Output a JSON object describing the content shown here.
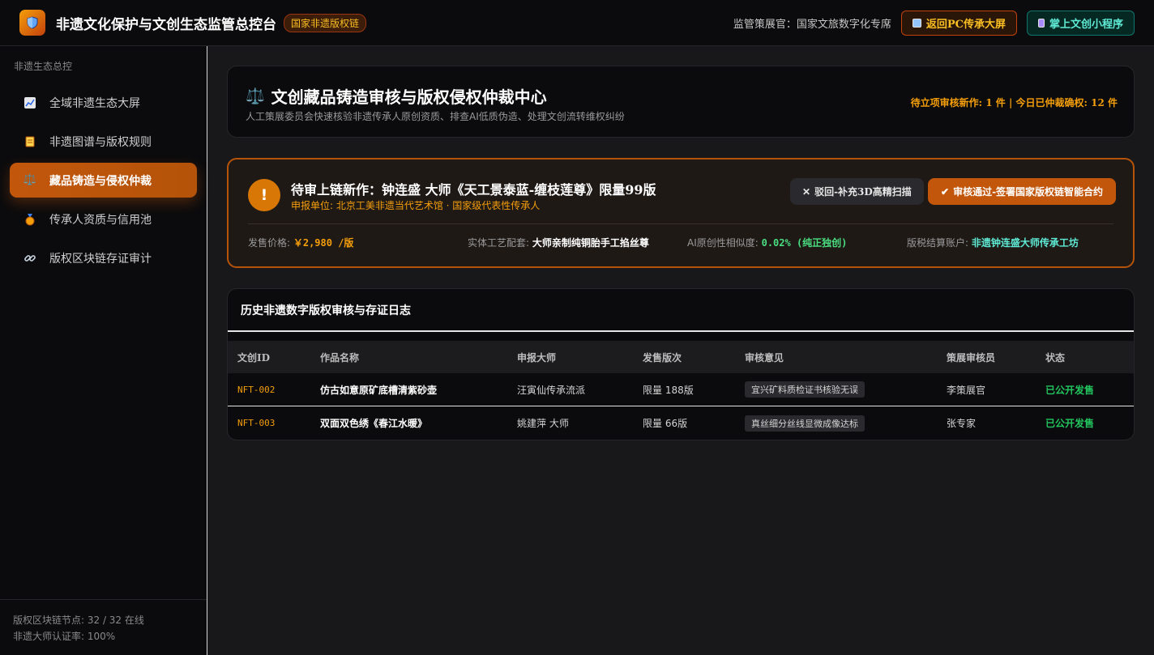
{
  "header": {
    "title": "非遗文化保护与文创生态监管总控台",
    "badge": "国家非遗版权链",
    "curator_label": "监管策展官：国家文旅数字化专席",
    "pc_button": "返回PC传承大屏",
    "mini_button": "掌上文创小程序"
  },
  "sidebar": {
    "section_title": "非遗生态总控",
    "items": [
      {
        "label": "全域非遗生态大屏",
        "icon": "chart-icon"
      },
      {
        "label": "非遗图谱与版权规则",
        "icon": "scroll-icon"
      },
      {
        "label": "藏品铸造与侵权仲裁",
        "icon": "scale-icon",
        "active": true
      },
      {
        "label": "传承人资质与信用池",
        "icon": "medal-icon"
      },
      {
        "label": "版权区块链存证审计",
        "icon": "link-icon"
      }
    ],
    "footer_nodes": "版权区块链节点: 32 / 32 在线",
    "footer_cert": "非遗大师认证率: 100%"
  },
  "page_header": {
    "title": "文创藏品铸造审核与版权侵权仲裁中心",
    "subtitle": "人工策展委员会快速核验非遗传承人原创资质、排查AI低质伪造、处理文创流转维权纠纷",
    "stats": "待立项审核新作: 1 件 | 今日已仲裁确权: 12 件"
  },
  "pending": {
    "icon_glyph": "!",
    "title": "待审上链新作：钟连盛 大师《天工景泰蓝-缠枝莲尊》限量99版",
    "unit": "申报单位: 北京工美非遗当代艺术馆 · 国家级代表性传承人",
    "reject_label": "驳回-补充3D高精扫描",
    "approve_label": "审核通过-签署国家版权链智能合约",
    "meta": [
      {
        "label": "发售价格: ",
        "value": "￥2,980 /版"
      },
      {
        "label": "实体工艺配套: ",
        "value": "大师亲制纯铜胎手工掐丝尊"
      },
      {
        "label": "AI原创性相似度: ",
        "value": "0.02% (纯正独创)"
      },
      {
        "label": "版税结算账户: ",
        "value": "非遗钟连盛大师传承工坊"
      }
    ]
  },
  "log": {
    "title": "历史非遗数字版权审核与存证日志",
    "columns": [
      "文创ID",
      "作品名称",
      "申报大师",
      "发售版次",
      "审核意见",
      "策展审核员",
      "状态"
    ],
    "rows": [
      {
        "id": "NFT-002",
        "work": "仿古如意原矿底槽清紫砂壶",
        "master": "汪寅仙传承流派",
        "edition": "限量 188版",
        "opinion": "宜兴矿料质检证书核验无误",
        "reviewer": "李策展官",
        "status": "已公开发售"
      },
      {
        "id": "NFT-003",
        "work": "双面双色绣《春江水暖》",
        "master": "姚建萍 大师",
        "edition": "限量 66版",
        "opinion": "真丝细分丝线显微成像达标",
        "reviewer": "张专家",
        "status": "已公开发售"
      }
    ]
  },
  "colors": {
    "accent": "#c2570c",
    "gold": "#f59e0b",
    "teal": "#5eead4",
    "success": "#22c55e"
  }
}
